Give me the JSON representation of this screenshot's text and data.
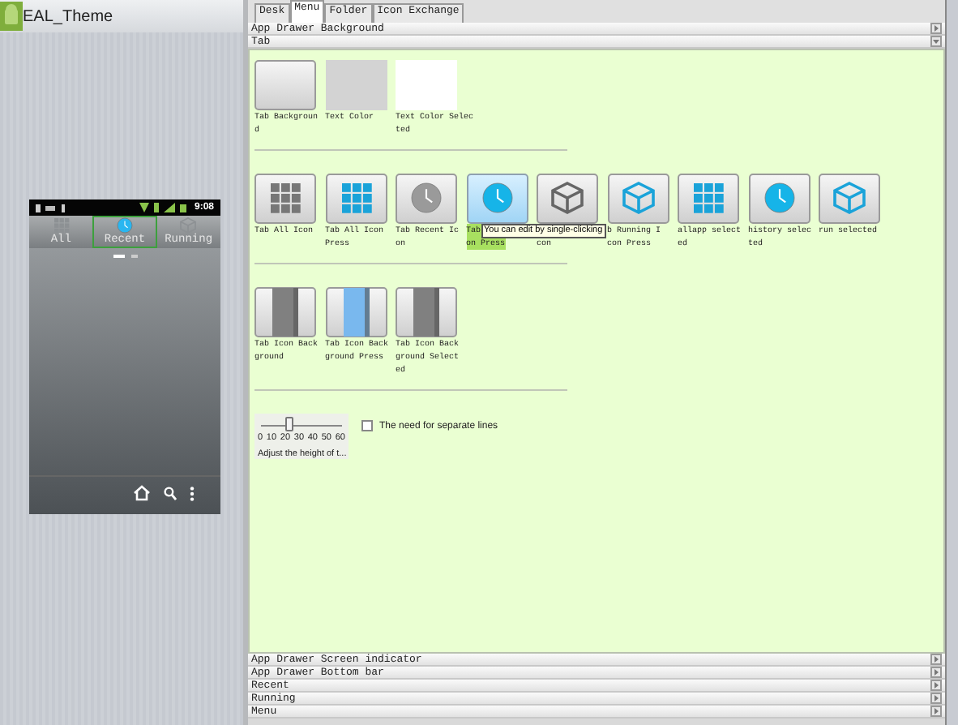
{
  "app": {
    "title": "EAL_Theme"
  },
  "phone": {
    "time": "9:08",
    "tabs": [
      {
        "label": "All",
        "selected": false,
        "kind": "grid"
      },
      {
        "label": "Recent",
        "selected": true,
        "kind": "clock"
      },
      {
        "label": "Running",
        "selected": false,
        "kind": "cube"
      }
    ]
  },
  "tabs": [
    {
      "label": "Desk",
      "selected": false
    },
    {
      "label": "Menu",
      "selected": true
    },
    {
      "label": "Folder",
      "selected": false
    },
    {
      "label": "Icon Exchange",
      "selected": false
    }
  ],
  "sections_top": [
    {
      "label": "App Drawer Background",
      "expanded": false
    },
    {
      "label": "Tab",
      "expanded": true
    }
  ],
  "groups": [
    {
      "items": [
        {
          "kind": "tile",
          "lines": [
            "Tab Backgroun",
            "d"
          ],
          "selected": false
        },
        {
          "kind": "swatch",
          "color": "#d3d3d3",
          "lines": [
            "Text Color"
          ],
          "selected": false
        },
        {
          "kind": "swatch",
          "color": "#ffffff",
          "lines": [
            "Text Color Selec",
            "ted"
          ],
          "selected": false
        }
      ]
    },
    {
      "items": [
        {
          "kind": "grid",
          "color": "#777777",
          "lines": [
            "Tab All Icon"
          ],
          "selected": false
        },
        {
          "kind": "grid",
          "color": "#1aa3d9",
          "lines": [
            "Tab All Icon",
            "Press"
          ],
          "selected": false
        },
        {
          "kind": "clock",
          "color": "#9a9a9a",
          "lines": [
            "Tab Recent Ic",
            "on"
          ],
          "selected": false
        },
        {
          "kind": "clock",
          "color": "#16b4e8",
          "lines": [
            "Tab",
            "on Press"
          ],
          "selected": true,
          "tooltip": "You can edit by single-clicking"
        },
        {
          "kind": "cube",
          "color": "#666666",
          "lines": [
            "con"
          ],
          "covered": true,
          "selected": false
        },
        {
          "kind": "cube",
          "color": "#1aa3d9",
          "lines": [
            "b Running I",
            "con Press"
          ],
          "selected": false
        },
        {
          "kind": "grid",
          "color": "#1aa3d9",
          "lines": [
            "allapp select",
            "ed"
          ],
          "selected": false
        },
        {
          "kind": "clock",
          "color": "#16b4e8",
          "lines": [
            "history selec",
            "ted"
          ],
          "selected": false
        },
        {
          "kind": "cube",
          "color": "#1aa3d9",
          "lines": [
            "run selected"
          ],
          "selected": false
        }
      ]
    },
    {
      "items": [
        {
          "kind": "strip",
          "color": "#808080",
          "lines": [
            "Tab Icon Back",
            "ground"
          ],
          "selected": false
        },
        {
          "kind": "strip",
          "color": "#79b8ee",
          "lines": [
            "Tab Icon Back",
            "ground Press"
          ],
          "selected": false
        },
        {
          "kind": "strip",
          "color": "#808080",
          "lines": [
            "Tab Icon Back",
            "ground Select",
            "ed"
          ],
          "selected": false
        }
      ]
    }
  ],
  "slider": {
    "level": 0.333,
    "ticks": [
      "0",
      "10",
      "20",
      "30",
      "40",
      "50",
      "60"
    ],
    "caption": "Adjust the height of t..."
  },
  "checkbox": {
    "label": "The need for separate lines",
    "checked": false
  },
  "sections_bottom": [
    {
      "label": "App Drawer Screen indicator",
      "expanded": false
    },
    {
      "label": "App Drawer Bottom bar",
      "expanded": false
    },
    {
      "label": "Recent",
      "expanded": false
    },
    {
      "label": "Running",
      "expanded": false
    },
    {
      "label": "Menu",
      "expanded": false
    }
  ]
}
